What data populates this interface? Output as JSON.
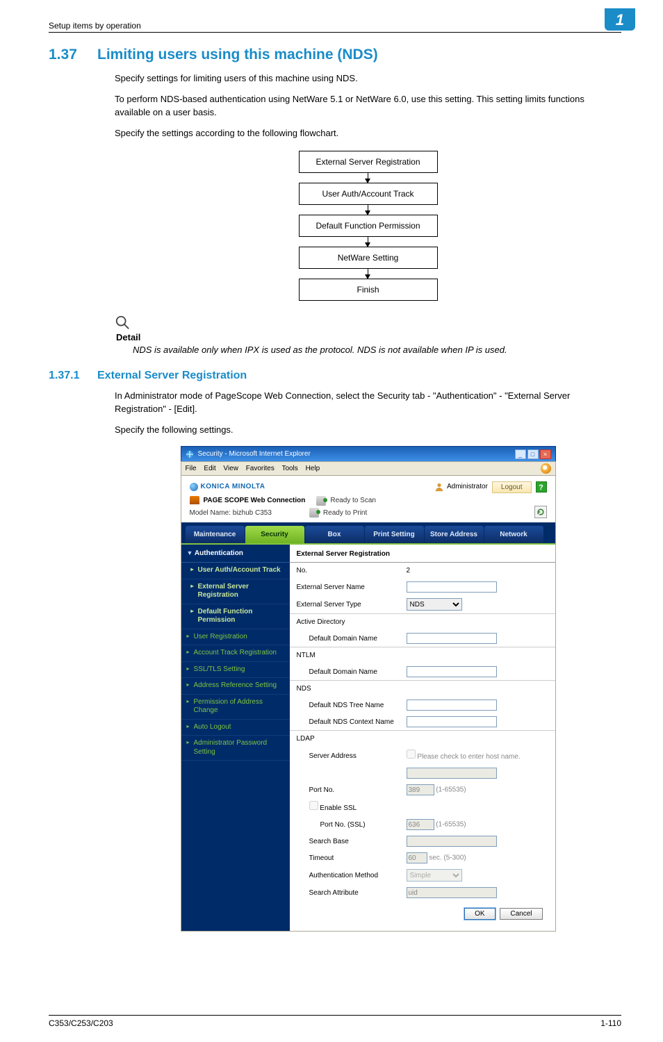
{
  "header": {
    "left": "Setup items by operation",
    "badge": "1"
  },
  "section": {
    "number": "1.37",
    "title": "Limiting users using this machine (NDS)",
    "p1": "Specify settings for limiting users of this machine using NDS.",
    "p2": "To perform NDS-based authentication using NetWare 5.1 or NetWare 6.0, use this setting. This setting limits functions available on a user basis.",
    "p3": "Specify the settings according to the following flowchart."
  },
  "flow": [
    "External Server Registration",
    "User Auth/Account Track",
    "Default Function Permission",
    "NetWare Setting",
    "Finish"
  ],
  "detail": {
    "label": "Detail",
    "text": "NDS is available only when IPX is used as the protocol. NDS is not available when IP is used."
  },
  "subsection": {
    "number": "1.37.1",
    "title": "External Server Registration",
    "p1": "In Administrator mode of PageScope Web Connection, select the Security tab - \"Authentication\" - \"External Server Registration\" - [Edit].",
    "p2": "Specify the following settings."
  },
  "ie": {
    "title": "Security - Microsoft Internet Explorer",
    "menus": [
      "File",
      "Edit",
      "View",
      "Favorites",
      "Tools",
      "Help"
    ]
  },
  "appHeader": {
    "brand": "KONICA MINOLTA",
    "product": "PAGE SCOPE Web Connection",
    "status1": "Ready to Scan",
    "status2": "Ready to Print",
    "model": "Model Name: bizhub C353",
    "adminLabel": "Administrator",
    "logout": "Logout",
    "help": "?"
  },
  "tabs": [
    "Maintenance",
    "Security",
    "Box",
    "Print Setting",
    "Store Address",
    "Network"
  ],
  "activeTab": 1,
  "sidebar": {
    "group": "Authentication",
    "items": [
      {
        "label": "User Auth/Account Track",
        "nested": true
      },
      {
        "label": "External Server\nRegistration",
        "nested": true
      },
      {
        "label": "Default Function\nPermission",
        "nested": true
      },
      {
        "label": "User Registration"
      },
      {
        "label": "Account Track Registration"
      },
      {
        "label": "SSL/TLS Setting"
      },
      {
        "label": "Address Reference Setting"
      },
      {
        "label": "Permission of Address\nChange"
      },
      {
        "label": "Auto Logout"
      },
      {
        "label": "Administrator Password\nSetting"
      }
    ]
  },
  "panel": {
    "title": "External Server Registration",
    "fields": {
      "no_label": "No.",
      "no_value": "2",
      "esn_label": "External Server Name",
      "est_label": "External Server Type",
      "est_value": "NDS",
      "ad_group": "Active Directory",
      "ad_ddn": "Default Domain Name",
      "ntlm_group": "NTLM",
      "ntlm_ddn": "Default Domain Name",
      "nds_group": "NDS",
      "nds_tree": "Default NDS Tree Name",
      "nds_ctx": "Default NDS Context Name",
      "ldap_group": "LDAP",
      "ldap_server": "Server Address",
      "ldap_hostchk": "Please check to enter host name.",
      "port_label": "Port No.",
      "port_value": "389",
      "port_range": "(1-65535)",
      "ssl_label": "Enable SSL",
      "portssl_label": "Port No. (SSL)",
      "portssl_value": "636",
      "portssl_range": "(1-65535)",
      "search_label": "Search Base",
      "timeout_label": "Timeout",
      "timeout_value": "60",
      "timeout_range": "sec. (5-300)",
      "authm_label": "Authentication Method",
      "authm_value": "Simple",
      "sattr_label": "Search Attribute",
      "sattr_value": "uid"
    },
    "ok": "OK",
    "cancel": "Cancel"
  },
  "footer": {
    "left": "C353/C253/C203",
    "right": "1-110"
  }
}
